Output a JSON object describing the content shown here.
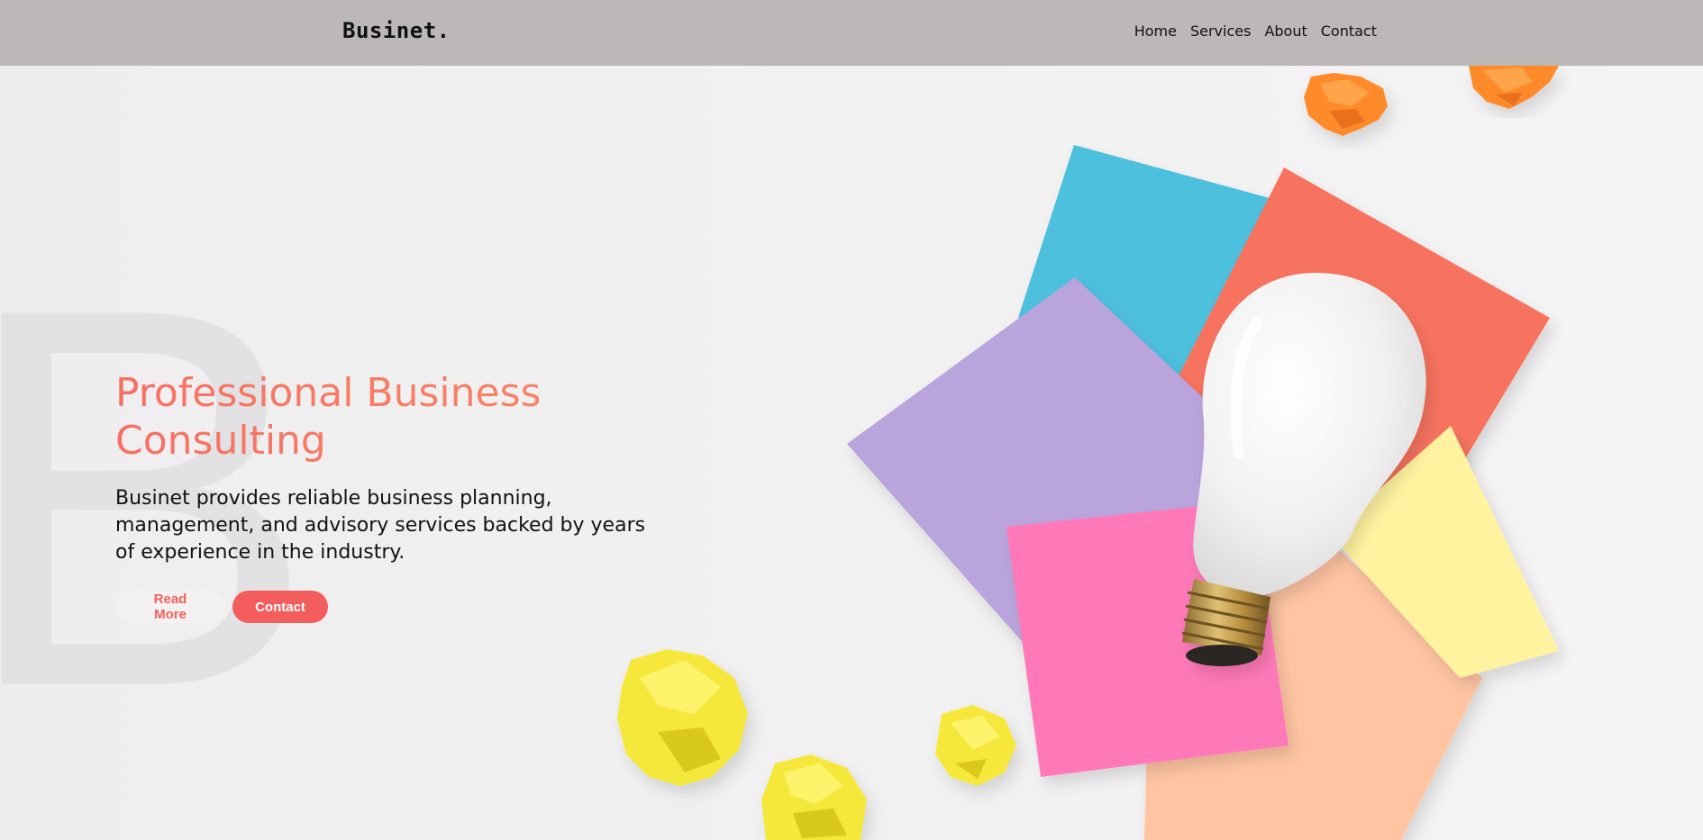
{
  "header": {
    "logo": "Businet.",
    "nav": [
      "Home",
      "Services",
      "About",
      "Contact"
    ]
  },
  "hero": {
    "watermark": "B",
    "title": "Professional Business Consulting",
    "subtitle": "Businet provides reliable business planning, management, and advisory services backed by years of experience in the industry.",
    "read_more": "Read More",
    "contact": "Contact"
  },
  "colors": {
    "navbar": "#bbb8b7",
    "accent": "#f45d5d",
    "title_gradient_start": "#f76f62",
    "title_gradient_end": "#f88a68"
  }
}
